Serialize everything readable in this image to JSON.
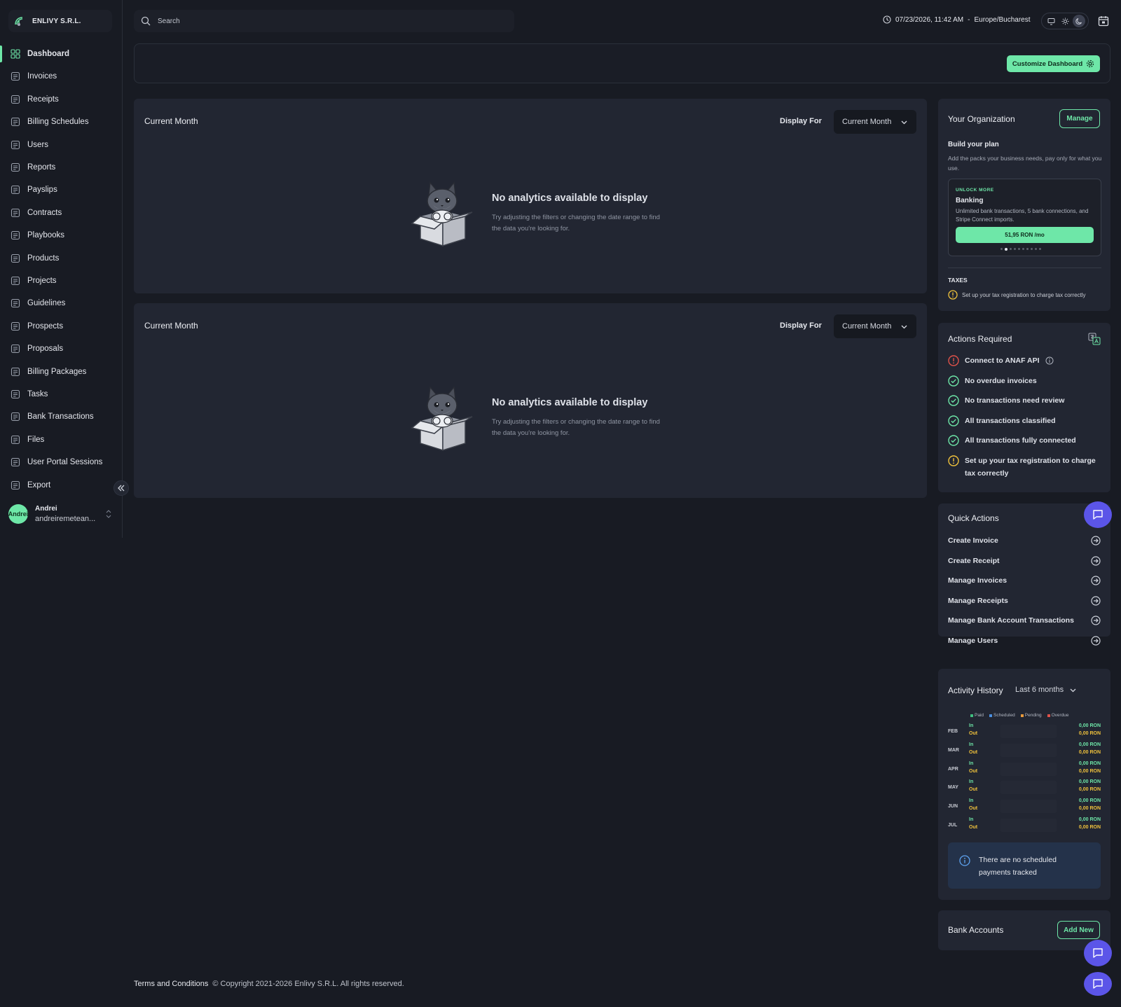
{
  "org": {
    "name": "ENLIVY S.R.L."
  },
  "sidebar": {
    "items": [
      {
        "label": "Dashboard",
        "icon": "grid-icon",
        "active": true
      },
      {
        "label": "Invoices",
        "icon": "invoice-icon"
      },
      {
        "label": "Receipts",
        "icon": "receipt-icon"
      },
      {
        "label": "Billing Schedules",
        "icon": "calendar-icon"
      },
      {
        "label": "Users",
        "icon": "users-icon"
      },
      {
        "label": "Reports",
        "icon": "report-icon"
      },
      {
        "label": "Payslips",
        "icon": "payslip-icon"
      },
      {
        "label": "Contracts",
        "icon": "contract-icon"
      },
      {
        "label": "Playbooks",
        "icon": "book-icon"
      },
      {
        "label": "Products",
        "icon": "box-icon"
      },
      {
        "label": "Projects",
        "icon": "project-icon"
      },
      {
        "label": "Guidelines",
        "icon": "guideline-icon"
      },
      {
        "label": "Prospects",
        "icon": "prospect-icon"
      },
      {
        "label": "Proposals",
        "icon": "proposal-icon"
      },
      {
        "label": "Billing Packages",
        "icon": "package-icon"
      },
      {
        "label": "Tasks",
        "icon": "task-icon"
      },
      {
        "label": "Bank Transactions",
        "icon": "bank-icon"
      },
      {
        "label": "Files",
        "icon": "file-icon"
      },
      {
        "label": "User Portal Sessions",
        "icon": "portal-icon"
      },
      {
        "label": "Export",
        "icon": "export-icon"
      }
    ]
  },
  "user": {
    "avatar_text": "Andrei",
    "name": "Andrei",
    "email": "andreiremetean..."
  },
  "search": {
    "placeholder": "Search"
  },
  "datetime": {
    "text": "07/23/2026, 11:42 AM",
    "separator": "-",
    "tz": "Europe/Bucharest"
  },
  "banner": {
    "customize_label": "Customize Dashboard"
  },
  "analytics": [
    {
      "title": "Current Month",
      "display_for": "Display For",
      "select": "Current Month",
      "empty_title": "No analytics available to display",
      "empty_text": "Try adjusting the filters or changing the date range to find the data you're looking for."
    },
    {
      "title": "Current Month",
      "display_for": "Display For",
      "select": "Current Month",
      "empty_title": "No analytics available to display",
      "empty_text": "Try adjusting the filters or changing the date range to find the data you're looking for."
    }
  ],
  "organization": {
    "title": "Your Organization",
    "manage": "Manage",
    "plan_title": "Build your plan",
    "plan_text": "Add the packs your business needs, pay only for what you use.",
    "unlock": "UNLOCK MORE",
    "pack_name": "Banking",
    "pack_text": "Unlimited bank transactions, 5 bank connections, and Stripe Connect imports.",
    "price": "51,95 RON /mo",
    "taxes_title": "TAXES",
    "taxes_text": "Set up your tax registration to charge tax correctly"
  },
  "actions": {
    "title": "Actions Required",
    "items": [
      {
        "label": "Connect to ANAF API",
        "status": "error"
      },
      {
        "label": "No overdue invoices",
        "status": "ok"
      },
      {
        "label": "No transactions need review",
        "status": "ok"
      },
      {
        "label": "All transactions classified",
        "status": "ok"
      },
      {
        "label": "All transactions fully connected",
        "status": "ok"
      },
      {
        "label": "Set up your tax registration to charge tax correctly",
        "status": "warn"
      }
    ]
  },
  "quick": {
    "title": "Quick Actions",
    "items": [
      "Create Invoice",
      "Create Receipt",
      "Manage Invoices",
      "Manage Receipts",
      "Manage Bank Account Transactions",
      "Manage Users"
    ]
  },
  "history": {
    "title": "Activity History",
    "range": "Last 6 months",
    "legend": [
      {
        "label": "Paid",
        "color": "#3fbf7f"
      },
      {
        "label": "Scheduled",
        "color": "#4a8fe0"
      },
      {
        "label": "Pending",
        "color": "#e89a3c"
      },
      {
        "label": "Overdue",
        "color": "#e0524a"
      }
    ],
    "in_label": "In",
    "out_label": "Out",
    "rows": [
      {
        "month": "FEB",
        "in": "0,00 RON",
        "out": "0,00 RON"
      },
      {
        "month": "MAR",
        "in": "0,00 RON",
        "out": "0,00 RON"
      },
      {
        "month": "APR",
        "in": "0,00 RON",
        "out": "0,00 RON"
      },
      {
        "month": "MAY",
        "in": "0,00 RON",
        "out": "0,00 RON"
      },
      {
        "month": "JUN",
        "in": "0,00 RON",
        "out": "0,00 RON"
      },
      {
        "month": "JUL",
        "in": "0,00 RON",
        "out": "0,00 RON"
      }
    ],
    "notice": "There are no scheduled payments tracked"
  },
  "bank": {
    "title": "Bank Accounts",
    "add": "Add New"
  },
  "footer": {
    "terms": "Terms and Conditions",
    "copyright": "© Copyright 2021-2026 Enlivy S.R.L. All rights reserved."
  },
  "colors": {
    "accent": "#6ee7a8",
    "chat": "#5b55e8",
    "in": "#6ee7a8",
    "out": "#f0c23c"
  }
}
